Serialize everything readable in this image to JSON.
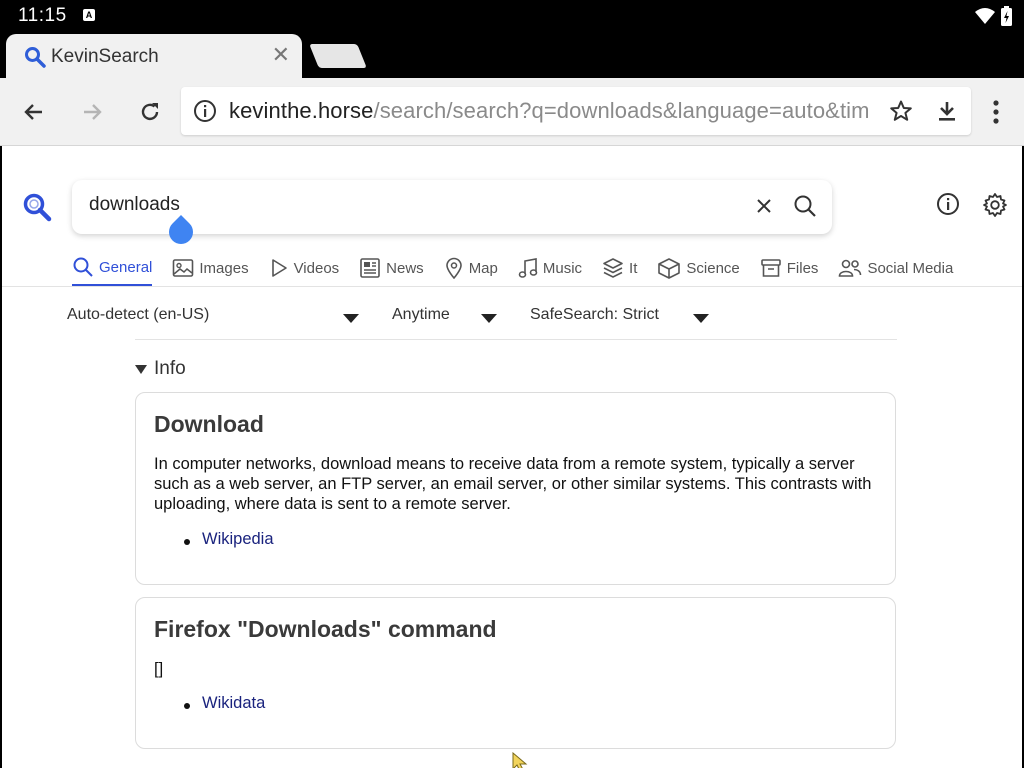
{
  "status": {
    "time": "11:15",
    "notif": "A"
  },
  "tab": {
    "title": "KevinSearch"
  },
  "url": {
    "host": "kevinthe.horse",
    "path": "/search/search?q=downloads&language=auto&tim"
  },
  "search": {
    "query": "downloads"
  },
  "categories": [
    {
      "label": "General",
      "icon": "search-icon"
    },
    {
      "label": "Images",
      "icon": "image-icon"
    },
    {
      "label": "Videos",
      "icon": "play-icon"
    },
    {
      "label": "News",
      "icon": "newspaper-icon"
    },
    {
      "label": "Map",
      "icon": "map-pin-icon"
    },
    {
      "label": "Music",
      "icon": "music-note-icon"
    },
    {
      "label": "It",
      "icon": "layers-icon"
    },
    {
      "label": "Science",
      "icon": "cube-icon"
    },
    {
      "label": "Files",
      "icon": "file-box-icon"
    },
    {
      "label": "Social Media",
      "icon": "people-icon"
    }
  ],
  "filters": {
    "language": "Auto-detect (en-US)",
    "time": "Anytime",
    "safesearch": "SafeSearch: Strict"
  },
  "info": {
    "label": "Info",
    "cards": [
      {
        "title": "Download",
        "body": "In computer networks, download means to receive data from a remote system, typically a server such as a web server, an FTP server, an email server, or other similar systems. This contrasts with uploading, where data is sent to a remote server.",
        "link": "Wikipedia"
      },
      {
        "title": "Firefox \"Downloads\" command",
        "body": "[]",
        "link": "Wikidata"
      }
    ]
  },
  "colors": {
    "accent": "#3050d8",
    "link": "#1a237e",
    "handle": "#3f84f2"
  }
}
